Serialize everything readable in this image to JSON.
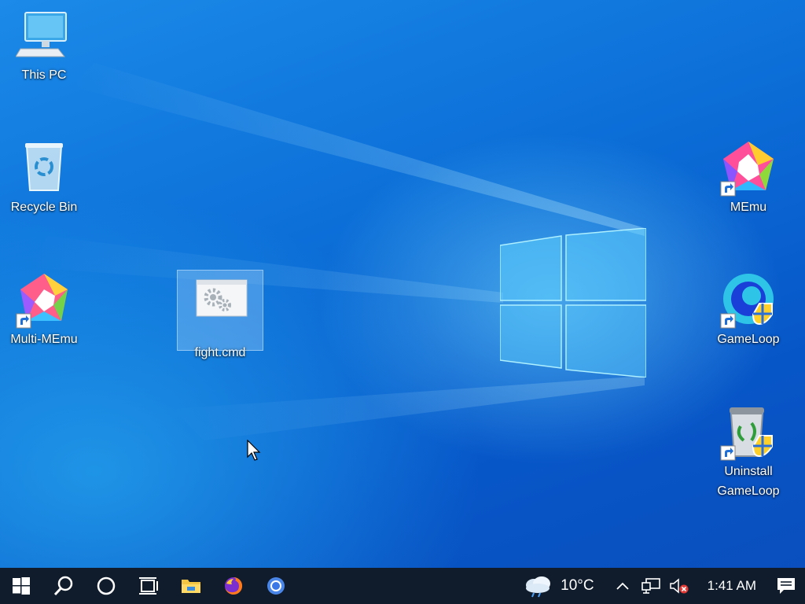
{
  "desktop": {
    "icons": [
      {
        "label": "This PC",
        "icon": "this-pc-icon"
      },
      {
        "label": "Recycle Bin",
        "icon": "recycle-bin-icon"
      },
      {
        "label": "Multi-MEmu",
        "icon": "multi-memu-icon"
      },
      {
        "label": "fight.cmd",
        "icon": "cmd-file-icon"
      },
      {
        "label": "MEmu",
        "icon": "memu-icon"
      },
      {
        "label": "GameLoop",
        "icon": "gameloop-icon"
      },
      {
        "label": "Uninstall GameLoop",
        "icon": "uninstall-gameloop-icon"
      }
    ]
  },
  "taskbar": {
    "weather": {
      "temp": "10°C",
      "icon": "cloud-rain-icon"
    },
    "clock": {
      "time": "1:41 AM"
    }
  },
  "colors": {
    "taskbar": "#101c2c",
    "accent": "#0a6fd6"
  }
}
